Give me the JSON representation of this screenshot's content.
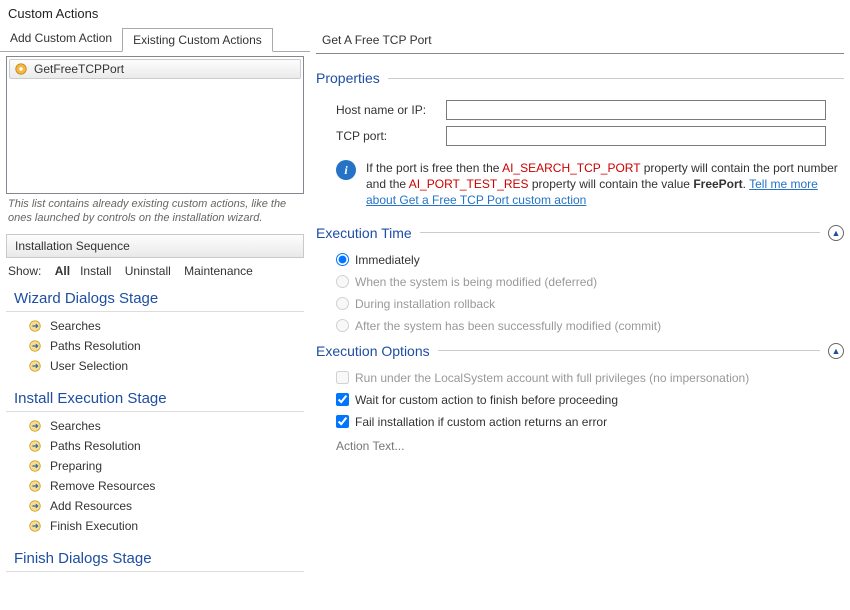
{
  "title": "Custom Actions",
  "tabs": {
    "add": "Add Custom Action",
    "existing": "Existing Custom Actions"
  },
  "list": {
    "item": "GetFreeTCPPort"
  },
  "hint": "This list contains already existing custom actions, like the ones launched by controls on the installation wizard.",
  "seq": {
    "header": "Installation Sequence",
    "showLabel": "Show:",
    "all": "All",
    "install": "Install",
    "uninstall": "Uninstall",
    "maintenance": "Maintenance"
  },
  "stages": {
    "wizard": {
      "title": "Wizard Dialogs Stage",
      "items": [
        "Searches",
        "Paths Resolution",
        "User Selection"
      ]
    },
    "install": {
      "title": "Install Execution Stage",
      "items": [
        "Searches",
        "Paths Resolution",
        "Preparing",
        "Remove Resources",
        "Add Resources",
        "Finish Execution"
      ]
    },
    "finish": {
      "title": "Finish Dialogs Stage"
    }
  },
  "panel": {
    "title": "Get A Free TCP Port",
    "properties": {
      "heading": "Properties",
      "hostLabel": "Host name or IP:",
      "hostValue": "",
      "portLabel": "TCP port:",
      "portValue": "",
      "info1": "If the port is free then the ",
      "kw1": "AI_SEARCH_TCP_PORT",
      "info2": " property will contain the port number and the ",
      "kw2": "AI_PORT_TEST_RES",
      "info3": " property will contain the value ",
      "kw3": "FreePort",
      "info4": ". ",
      "link": "Tell me more about Get a Free TCP Port custom action"
    },
    "execTime": {
      "heading": "Execution Time",
      "immediately": "Immediately",
      "deferred": "When the system is being modified (deferred)",
      "rollback": "During installation rollback",
      "commit": "After the system has been successfully modified (commit)"
    },
    "execOpt": {
      "heading": "Execution Options",
      "local": "Run under the LocalSystem account with full privileges (no impersonation)",
      "wait": "Wait for custom action to finish before proceeding",
      "fail": "Fail installation if custom action returns an error",
      "actionText": "Action Text..."
    }
  }
}
